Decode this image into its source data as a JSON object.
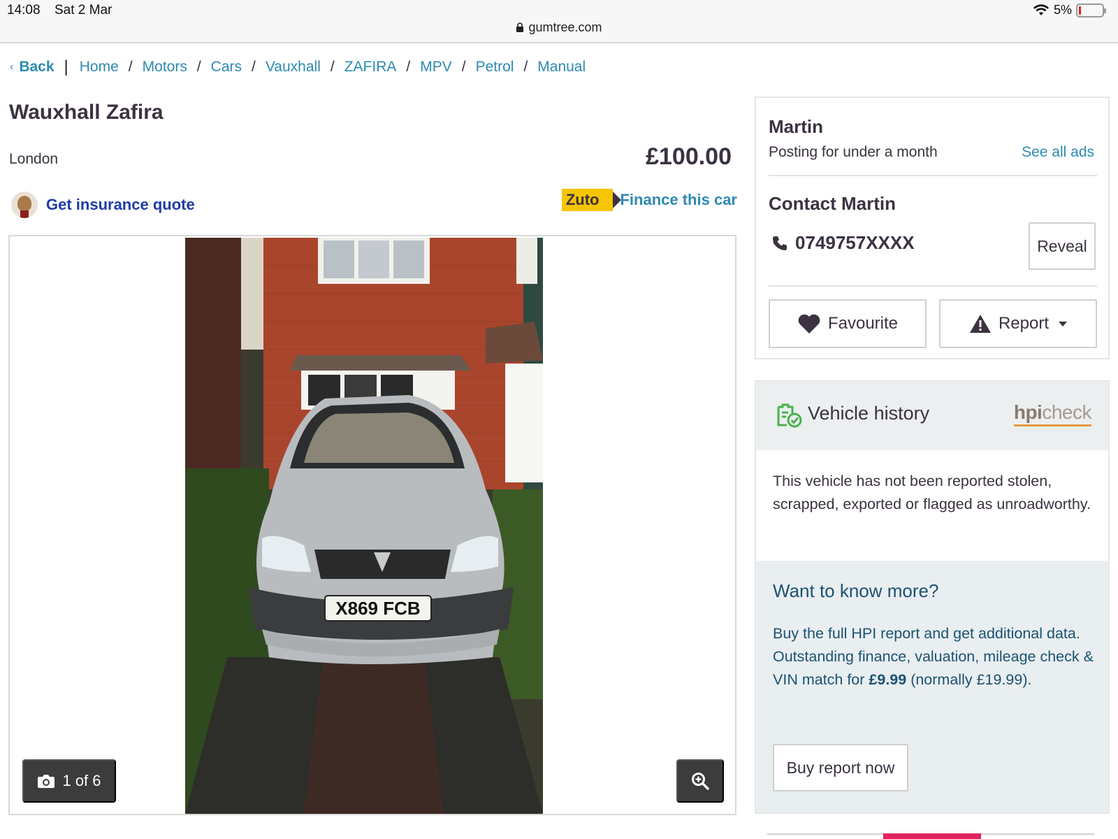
{
  "status_bar": {
    "time": "14:08",
    "date": "Sat 2 Mar",
    "battery": "5%",
    "url": "gumtree.com"
  },
  "breadcrumb": {
    "back": "Back",
    "items": [
      "Home",
      "Motors",
      "Cars",
      "Vauxhall",
      "ZAFIRA",
      "MPV",
      "Petrol",
      "Manual"
    ]
  },
  "ad": {
    "title": "Wauxhall Zafira",
    "location": "London",
    "price": "£100.00",
    "insurance_link": "Get insurance quote",
    "zuto_logo": "Zuto",
    "finance_link": "Finance this car",
    "photo_counter": "1 of 6",
    "number_plate": "X869 FCB"
  },
  "seller": {
    "name": "Martin",
    "posting": "Posting for under a month",
    "see_all": "See all ads",
    "contact_title": "Contact Martin",
    "phone": "0749757XXXX",
    "reveal": "Reveal",
    "favourite": "Favourite",
    "report": "Report"
  },
  "hpi": {
    "title": "Vehicle history",
    "logo_bold": "hpi",
    "logo_light": "check",
    "status_text": "This vehicle has not been reported stolen, scrapped, exported or flagged as unroadworthy.",
    "more_title": "Want to know more?",
    "more_line1": "Buy the full HPI report and get additional data.",
    "more_line2_pre": "Outstanding finance, valuation, mileage check & VIN match for ",
    "more_price": "£9.99",
    "more_line2_post": " (normally £19.99).",
    "buy_button": "Buy report now"
  },
  "colors": {
    "link": "#2d8ab1",
    "text": "#3c3241",
    "zuto": "#f5c500",
    "hpi_text": "#1a5371"
  }
}
